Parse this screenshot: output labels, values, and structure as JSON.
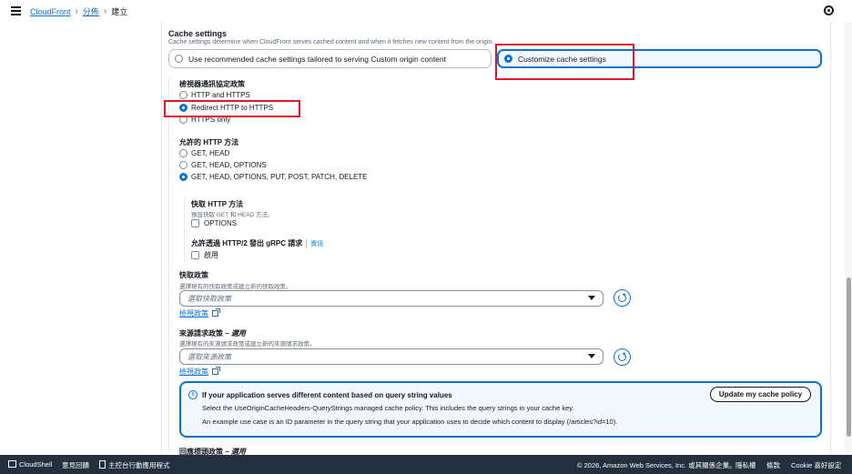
{
  "breadcrumb": {
    "items": [
      "CloudFront",
      "分佈",
      "建立"
    ]
  },
  "cache_settings": {
    "title": "Cache settings",
    "description": "Cache settings determine when CloudFront serves cached content and when it fetches new content from the origin.",
    "options": [
      "Use recommended cache settings tailored to serving Custom origin content",
      "Customize cache settings"
    ],
    "selected": "Customize cache settings"
  },
  "viewer_protocol": {
    "label": "檢視器通訊協定政策",
    "options": [
      "HTTP and HTTPS",
      "Redirect HTTP to HTTPS",
      "HTTPS only"
    ],
    "selected": "Redirect HTTP to HTTPS"
  },
  "allowed_methods": {
    "label": "允許的 HTTP 方法",
    "options": [
      "GET, HEAD",
      "GET, HEAD, OPTIONS",
      "GET, HEAD, OPTIONS, PUT, POST, PATCH, DELETE"
    ],
    "selected": "GET, HEAD, OPTIONS, PUT, POST, PATCH, DELETE",
    "cache_methods": {
      "label": "快取 HTTP 方法",
      "description": "預設快取 GET 和 HEAD 方法。",
      "checkbox": "OPTIONS",
      "checked": false
    },
    "grpc": {
      "label": "允許透過 HTTP/2 發出 gRPC 請求",
      "info": "資訊",
      "checkbox": "啟用",
      "checked": false
    }
  },
  "cache_policy": {
    "label": "快取政策",
    "description": "選擇現有的快取政策或建立新的快取政策。",
    "placeholder": "選取快取政策",
    "link": "檢視政策"
  },
  "origin_request_policy": {
    "label": "來源請求政策 – ",
    "optional": "選用",
    "description": "選擇現有的來源請求政策或建立新的來源請求政策。",
    "placeholder": "選取來源政策",
    "link": "檢視政策"
  },
  "alert": {
    "title": "If your application serves different content based on query string values",
    "line1": "Select the UseOriginCacheHeaders-QueryStrings managed cache policy. This includes the query strings in your cache key.",
    "line2": "An example use case is an ID parameter in the query string that your application uses to decide which content to display (/articles?id=10).",
    "button": "Update my cache policy"
  },
  "response_headers": {
    "label": "回應標頭政策 – ",
    "optional": "選用"
  },
  "footer": {
    "cloudshell": "CloudShell",
    "feedback": "意見回饋",
    "console_app": "主控台行動應用程式",
    "copyright": "© 2026, Amazon Web Services, Inc. 或其關係企業。",
    "privacy": "隱私權",
    "terms": "條款",
    "cookies": "Cookie 喜好設定"
  },
  "colors": {
    "accent": "#0972d3",
    "highlight": "#e0162b",
    "footer_bg": "#232f3e"
  }
}
